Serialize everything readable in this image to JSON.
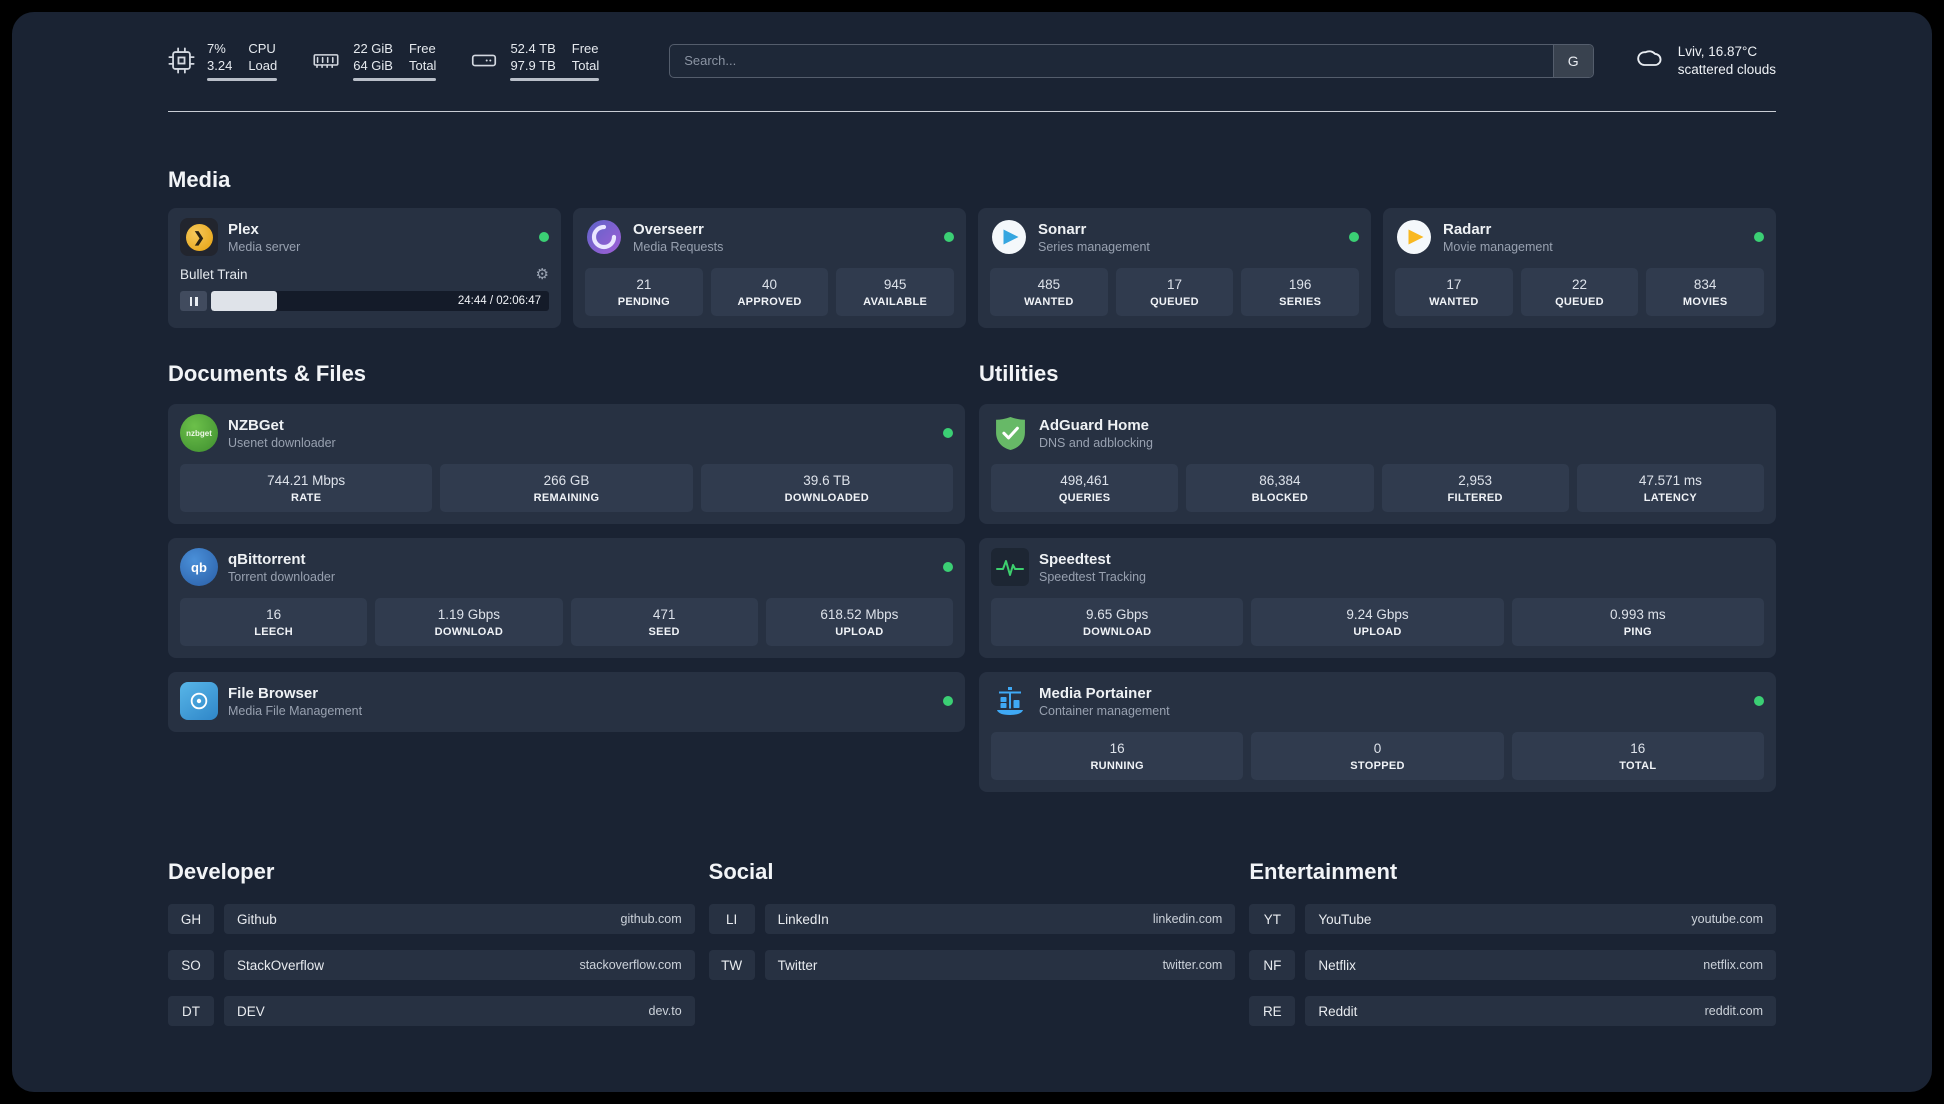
{
  "topbar": {
    "cpu": {
      "v1": "7%",
      "v2": "3.24",
      "l1": "CPU",
      "l2": "Load"
    },
    "ram": {
      "v1": "22 GiB",
      "v2": "64 GiB",
      "l1": "Free",
      "l2": "Total"
    },
    "disk": {
      "v1": "52.4 TB",
      "v2": "97.9 TB",
      "l1": "Free",
      "l2": "Total"
    },
    "search": {
      "placeholder": "Search...",
      "engine": "G"
    },
    "weather": {
      "location": "Lviv, 16.87°C",
      "condition": "scattered clouds"
    }
  },
  "icons": {
    "gear": "⚙",
    "nzbget": "nzbget",
    "qb": "qb"
  },
  "sections": {
    "media": "Media",
    "documents": "Documents & Files",
    "utilities": "Utilities"
  },
  "media": {
    "plex": {
      "name": "Plex",
      "desc": "Media server",
      "now_playing": "Bullet Train",
      "time": "24:44 / 02:06:47"
    },
    "overseerr": {
      "name": "Overseerr",
      "desc": "Media Requests",
      "stats": [
        {
          "value": "21",
          "label": "PENDING"
        },
        {
          "value": "40",
          "label": "APPROVED"
        },
        {
          "value": "945",
          "label": "AVAILABLE"
        }
      ]
    },
    "sonarr": {
      "name": "Sonarr",
      "desc": "Series management",
      "stats": [
        {
          "value": "485",
          "label": "WANTED"
        },
        {
          "value": "17",
          "label": "QUEUED"
        },
        {
          "value": "196",
          "label": "SERIES"
        }
      ]
    },
    "radarr": {
      "name": "Radarr",
      "desc": "Movie management",
      "stats": [
        {
          "value": "17",
          "label": "WANTED"
        },
        {
          "value": "22",
          "label": "QUEUED"
        },
        {
          "value": "834",
          "label": "MOVIES"
        }
      ]
    }
  },
  "documents": {
    "nzbget": {
      "name": "NZBGet",
      "desc": "Usenet downloader",
      "stats": [
        {
          "value": "744.21 Mbps",
          "label": "RATE"
        },
        {
          "value": "266 GB",
          "label": "REMAINING"
        },
        {
          "value": "39.6 TB",
          "label": "DOWNLOADED"
        }
      ]
    },
    "qbittorrent": {
      "name": "qBittorrent",
      "desc": "Torrent downloader",
      "stats": [
        {
          "value": "16",
          "label": "LEECH"
        },
        {
          "value": "1.19 Gbps",
          "label": "DOWNLOAD"
        },
        {
          "value": "471",
          "label": "SEED"
        },
        {
          "value": "618.52 Mbps",
          "label": "UPLOAD"
        }
      ]
    },
    "filebrowser": {
      "name": "File Browser",
      "desc": "Media File Management"
    }
  },
  "utilities": {
    "adguard": {
      "name": "AdGuard Home",
      "desc": "DNS and adblocking",
      "stats": [
        {
          "value": "498,461",
          "label": "QUERIES"
        },
        {
          "value": "86,384",
          "label": "BLOCKED"
        },
        {
          "value": "2,953",
          "label": "FILTERED"
        },
        {
          "value": "47.571 ms",
          "label": "LATENCY"
        }
      ]
    },
    "speedtest": {
      "name": "Speedtest",
      "desc": "Speedtest Tracking",
      "stats": [
        {
          "value": "9.65 Gbps",
          "label": "DOWNLOAD"
        },
        {
          "value": "9.24 Gbps",
          "label": "UPLOAD"
        },
        {
          "value": "0.993 ms",
          "label": "PING"
        }
      ]
    },
    "portainer": {
      "name": "Media Portainer",
      "desc": "Container management",
      "stats": [
        {
          "value": "16",
          "label": "RUNNING"
        },
        {
          "value": "0",
          "label": "STOPPED"
        },
        {
          "value": "16",
          "label": "TOTAL"
        }
      ]
    }
  },
  "bookmarks": {
    "developer": {
      "title": "Developer",
      "items": [
        {
          "abbr": "GH",
          "name": "Github",
          "url": "github.com"
        },
        {
          "abbr": "SO",
          "name": "StackOverflow",
          "url": "stackoverflow.com"
        },
        {
          "abbr": "DT",
          "name": "DEV",
          "url": "dev.to"
        }
      ]
    },
    "social": {
      "title": "Social",
      "items": [
        {
          "abbr": "LI",
          "name": "LinkedIn",
          "url": "linkedin.com"
        },
        {
          "abbr": "TW",
          "name": "Twitter",
          "url": "twitter.com"
        }
      ]
    },
    "entertainment": {
      "title": "Entertainment",
      "items": [
        {
          "abbr": "YT",
          "name": "YouTube",
          "url": "youtube.com"
        },
        {
          "abbr": "NF",
          "name": "Netflix",
          "url": "netflix.com"
        },
        {
          "abbr": "RE",
          "name": "Reddit",
          "url": "reddit.com"
        }
      ]
    }
  }
}
